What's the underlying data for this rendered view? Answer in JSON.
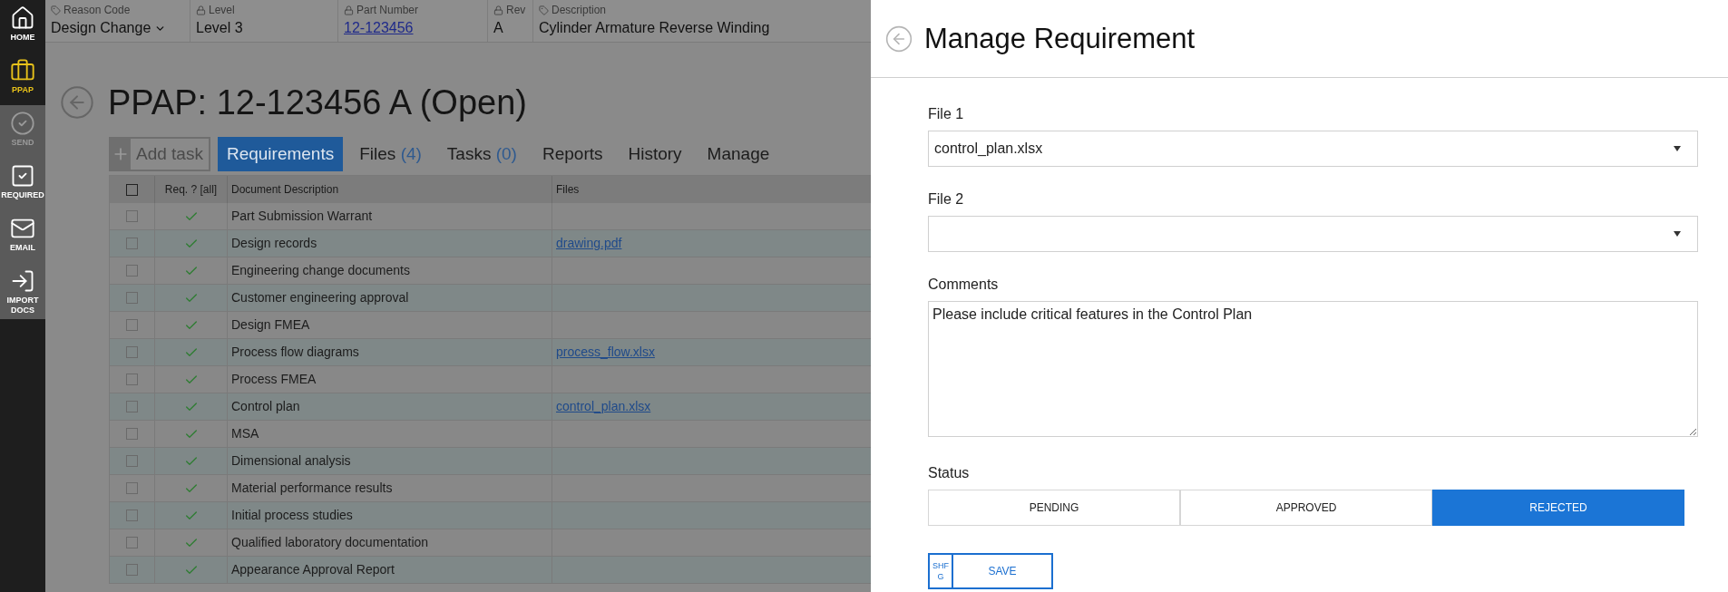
{
  "sidebar": {
    "items": [
      {
        "label": "HOME",
        "kind": "main",
        "selected": false,
        "disabled": false
      },
      {
        "label": "PPAP",
        "kind": "main",
        "selected": true,
        "disabled": false
      },
      {
        "label": "SEND",
        "kind": "action",
        "selected": false,
        "disabled": true
      },
      {
        "label": "REQUIRED",
        "kind": "action",
        "selected": false,
        "disabled": false
      },
      {
        "label": "EMAIL",
        "kind": "action",
        "selected": false,
        "disabled": false
      },
      {
        "label": "IMPORT DOCS",
        "kind": "action",
        "selected": false,
        "disabled": false
      }
    ]
  },
  "header_fields": [
    {
      "label": "Reason Code",
      "value": "Design Change",
      "kind": "dropdown",
      "locked": false
    },
    {
      "label": "Level",
      "value": "Level 3",
      "kind": "text",
      "locked": true
    },
    {
      "label": "Part Number",
      "value": "12-123456",
      "kind": "link",
      "locked": true
    },
    {
      "label": "Rev",
      "value": "A",
      "kind": "text",
      "locked": true
    },
    {
      "label": "Description",
      "value": "Cylinder Armature Reverse Winding",
      "kind": "text",
      "locked": false
    }
  ],
  "page_title": "PPAP: 12-123456 A (Open)",
  "add_task": {
    "label": "Add task",
    "disabled": true
  },
  "tabs": [
    {
      "label": "Requirements",
      "selected": true
    },
    {
      "label": "Files",
      "count": "(4)",
      "selected": false
    },
    {
      "label": "Tasks",
      "count": "(0)",
      "selected": false
    },
    {
      "label": "Reports",
      "selected": false
    },
    {
      "label": "History",
      "selected": false
    },
    {
      "label": "Manage",
      "selected": false
    }
  ],
  "table": {
    "header_checkbox": {
      "checked": false
    },
    "columns": [
      "Req. ? [all]",
      "Document Description",
      "Files"
    ],
    "rows": [
      {
        "checked": false,
        "required": true,
        "description": "Part Submission Warrant"
      },
      {
        "checked": false,
        "required": true,
        "description": "Design records",
        "file": "drawing.pdf"
      },
      {
        "checked": false,
        "required": true,
        "description": "Engineering change documents"
      },
      {
        "checked": false,
        "required": true,
        "description": "Customer engineering approval"
      },
      {
        "checked": false,
        "required": true,
        "description": "Design FMEA"
      },
      {
        "checked": false,
        "required": true,
        "description": "Process flow diagrams",
        "file": "process_flow.xlsx"
      },
      {
        "checked": false,
        "required": true,
        "description": "Process FMEA"
      },
      {
        "checked": false,
        "required": true,
        "description": "Control plan",
        "file": "control_plan.xlsx"
      },
      {
        "checked": false,
        "required": true,
        "description": "MSA"
      },
      {
        "checked": false,
        "required": true,
        "description": "Dimensional analysis"
      },
      {
        "checked": false,
        "required": true,
        "description": "Material performance results"
      },
      {
        "checked": false,
        "required": true,
        "description": "Initial process studies"
      },
      {
        "checked": false,
        "required": true,
        "description": "Qualified laboratory documentation"
      },
      {
        "checked": false,
        "required": true,
        "description": "Appearance Approval Report"
      }
    ]
  },
  "panel": {
    "title": "Manage Requirement",
    "file_1": {
      "label": "File 1",
      "value": "control_plan.xlsx"
    },
    "file_2": {
      "label": "File 2"
    },
    "comments": {
      "label": "Comments",
      "value": "Please include critical features in the Control Plan"
    },
    "status": {
      "label": "Status",
      "options": [
        {
          "label": "PENDING",
          "selected": false
        },
        {
          "label": "APPROVED",
          "selected": false
        },
        {
          "label": "REJECTED",
          "selected": true
        }
      ]
    },
    "save": {
      "shortcut": "SHFG",
      "label": "SAVE"
    }
  }
}
